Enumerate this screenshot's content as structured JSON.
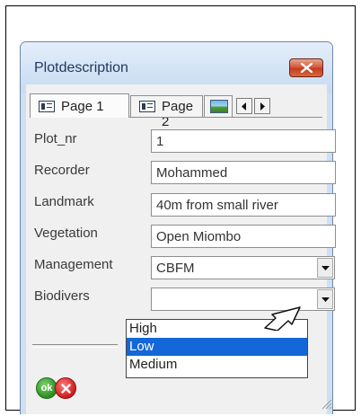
{
  "window": {
    "title": "Plotdescription"
  },
  "tabs": [
    {
      "label": "Page 1",
      "icon": "form-icon",
      "active": true
    },
    {
      "label": "Page 2",
      "icon": "form-icon",
      "active": false
    },
    {
      "label": "",
      "icon": "picture-icon",
      "active": false
    }
  ],
  "fields": [
    {
      "label": "Plot_nr",
      "value": "1"
    },
    {
      "label": "Recorder",
      "value": "Mohammed"
    },
    {
      "label": "Landmark",
      "value": "40m from small river"
    },
    {
      "label": "Vegetation",
      "value": "Open Miombo"
    },
    {
      "label": "Management",
      "value": "CBFM"
    },
    {
      "label": "Biodivers",
      "value": ""
    }
  ],
  "dropdown": {
    "options": [
      "High",
      "Low",
      "Medium"
    ],
    "selected": "Low"
  },
  "footer": {
    "ok_label": "ok"
  },
  "colors": {
    "title_bar": "#cfe0f2",
    "selection": "#1467d8",
    "ok_green": "#2c8d22",
    "cancel_red": "#d11b1b",
    "close_red": "#c33b20"
  }
}
